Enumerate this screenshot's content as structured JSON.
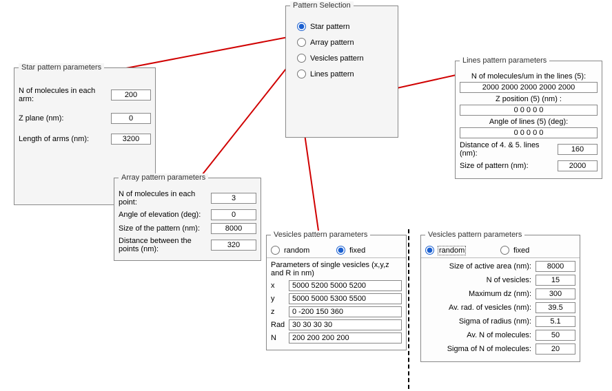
{
  "pattern_selection": {
    "legend": "Pattern Selection",
    "options": {
      "star": {
        "label": "Star pattern",
        "selected": true
      },
      "array": {
        "label": "Array pattern",
        "selected": false
      },
      "vesicles": {
        "label": "Vesicles pattern",
        "selected": false
      },
      "lines": {
        "label": "Lines pattern",
        "selected": false
      }
    }
  },
  "star": {
    "legend": "Star pattern parameters",
    "n_mol_label": "N of molecules in each arm:",
    "n_mol_value": "200",
    "z_plane_label": "Z plane (nm):",
    "z_plane_value": "0",
    "length_label": "Length of arms (nm):",
    "length_value": "3200"
  },
  "array": {
    "legend": "Array pattern parameters",
    "n_mol_label": "N of molecules in each point:",
    "n_mol_value": "3",
    "angle_label": "Angle of elevation (deg):",
    "angle_value": "0",
    "size_label": "Size of the pattern (nm):",
    "size_value": "8000",
    "dist_label": "Distance between the points (nm):",
    "dist_value": "320"
  },
  "lines": {
    "legend": "Lines pattern parameters",
    "n_mol_label": "N of molecules/um in the lines (5):",
    "n_mol_value": "2000 2000 2000 2000 2000",
    "z_pos_label": "Z position (5) (nm) :",
    "z_pos_value": "0 0 0 0 0",
    "angle_label": "Angle of lines (5) (deg):",
    "angle_value": "0 0 0 0 0",
    "dist45_label": "Distance of 4. & 5. lines  (nm):",
    "dist45_value": "160",
    "size_label": "Size of pattern (nm):",
    "size_value": "2000"
  },
  "vesicles_fixed": {
    "legend": "Vesicles pattern parameters",
    "random_label": "random",
    "fixed_label": "fixed",
    "mode_random": false,
    "mode_fixed": true,
    "subhead": "Parameters of single vesicles (x,y,z and R in nm)",
    "x_label": "x",
    "x_value": "5000 5200 5000 5200",
    "y_label": "y",
    "y_value": "5000 5000 5300 5500",
    "z_label": "z",
    "z_value": "0 -200 150 360",
    "rad_label": "Rad",
    "rad_value": "30 30 30 30",
    "n_label": "N",
    "n_value": "200 200 200 200"
  },
  "vesicles_random": {
    "legend": "Vesicles pattern parameters",
    "random_label": "random",
    "fixed_label": "fixed",
    "mode_random": true,
    "mode_fixed": false,
    "size_label": "Size of active area (nm):",
    "size_value": "8000",
    "n_ves_label": "N of vesicles:",
    "n_ves_value": "15",
    "max_dz_label": "Maximum dz (nm):",
    "max_dz_value": "300",
    "av_rad_label": "Av. rad. of vesicles (nm):",
    "av_rad_value": "39.5",
    "sigma_r_label": "Sigma of radius (nm):",
    "sigma_r_value": "5.1",
    "av_n_label": "Av. N of molecules:",
    "av_n_value": "50",
    "sigma_n_label": "Sigma of N of molecules:",
    "sigma_n_value": "20"
  }
}
